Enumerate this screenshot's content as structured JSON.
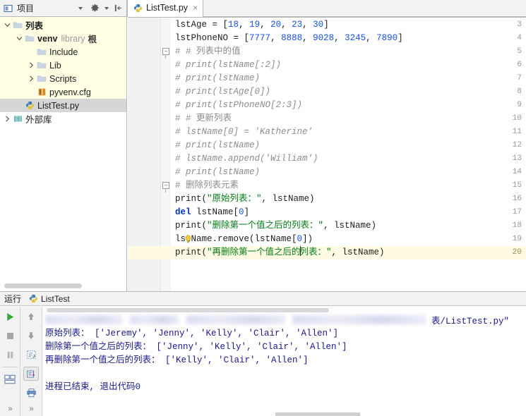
{
  "window": {
    "project_tool_title": "项目",
    "editor_tab": {
      "label": "ListTest.py",
      "close": "×"
    }
  },
  "toolbar": {
    "project_icon": "project-module-icon",
    "dropdown_icon": "chevron-down-icon",
    "settings_icon": "gear-icon",
    "settings_caret": "chevron-down-icon",
    "collapse_icon": "collapse-panel-icon"
  },
  "sidebar": {
    "tree": [
      {
        "id": "lists-root",
        "label": "列表",
        "sub": "",
        "indent": 0,
        "arrow": "expanded",
        "icon": "folder-icon",
        "bold": true,
        "selected": false,
        "yellow": true
      },
      {
        "id": "venv",
        "label": "venv",
        "sub": "library 根",
        "indent": 1,
        "arrow": "expanded",
        "icon": "folder-icon",
        "bold": true,
        "selected": false,
        "yellow": true
      },
      {
        "id": "include",
        "label": "Include",
        "sub": "",
        "indent": 2,
        "arrow": "none",
        "icon": "folder-icon",
        "bold": false,
        "selected": false,
        "yellow": true
      },
      {
        "id": "lib",
        "label": "Lib",
        "sub": "",
        "indent": 2,
        "arrow": "collapsed",
        "icon": "folder-icon",
        "bold": false,
        "selected": false,
        "yellow": true
      },
      {
        "id": "scripts",
        "label": "Scripts",
        "sub": "",
        "indent": 2,
        "arrow": "collapsed",
        "icon": "folder-icon",
        "bold": false,
        "selected": false,
        "yellow": true
      },
      {
        "id": "pyvenv-cfg",
        "label": "pyvenv.cfg",
        "sub": "",
        "indent": 2,
        "arrow": "none",
        "icon": "config-file-icon",
        "bold": false,
        "selected": false,
        "yellow": true
      },
      {
        "id": "listtest-py",
        "label": "ListTest.py",
        "sub": "",
        "indent": 1,
        "arrow": "none",
        "icon": "python-file-icon",
        "bold": false,
        "selected": true,
        "yellow": false
      },
      {
        "id": "external-libs",
        "label": "外部库",
        "sub": "",
        "indent": 0,
        "arrow": "collapsed",
        "icon": "library-icon",
        "bold": false,
        "selected": false,
        "yellow": false
      }
    ]
  },
  "editor": {
    "current_line": 20,
    "lines": [
      {
        "n": 3,
        "fold": null,
        "tokens": [
          {
            "t": "lstAge ",
            "c": "fn"
          },
          {
            "t": "= ",
            "c": "fn"
          },
          {
            "t": "[",
            "c": "fn"
          },
          {
            "t": "18",
            "c": "num"
          },
          {
            "t": ", ",
            "c": "fn"
          },
          {
            "t": "19",
            "c": "num"
          },
          {
            "t": ", ",
            "c": "fn"
          },
          {
            "t": "20",
            "c": "num"
          },
          {
            "t": ", ",
            "c": "fn"
          },
          {
            "t": "23",
            "c": "num"
          },
          {
            "t": ", ",
            "c": "fn"
          },
          {
            "t": "30",
            "c": "num"
          },
          {
            "t": "]",
            "c": "fn"
          }
        ]
      },
      {
        "n": 4,
        "fold": null,
        "tokens": [
          {
            "t": "lstPhoneNO ",
            "c": "fn"
          },
          {
            "t": "= ",
            "c": "fn"
          },
          {
            "t": "[",
            "c": "fn"
          },
          {
            "t": "7777",
            "c": "num"
          },
          {
            "t": ", ",
            "c": "fn"
          },
          {
            "t": "8888",
            "c": "num"
          },
          {
            "t": ", ",
            "c": "fn"
          },
          {
            "t": "9028",
            "c": "num"
          },
          {
            "t": ", ",
            "c": "fn"
          },
          {
            "t": "3245",
            "c": "num"
          },
          {
            "t": ", ",
            "c": "fn"
          },
          {
            "t": "7890",
            "c": "num"
          },
          {
            "t": "]",
            "c": "fn"
          }
        ]
      },
      {
        "n": 5,
        "fold": "open",
        "tokens": [
          {
            "t": "# # 列表中的值",
            "c": "cmz"
          }
        ]
      },
      {
        "n": 6,
        "fold": null,
        "tokens": [
          {
            "t": "# print(lstName[:2])",
            "c": "cm"
          }
        ]
      },
      {
        "n": 7,
        "fold": null,
        "tokens": [
          {
            "t": "# print(lstName)",
            "c": "cm"
          }
        ]
      },
      {
        "n": 8,
        "fold": null,
        "tokens": [
          {
            "t": "# print(lstAge[0])",
            "c": "cm"
          }
        ]
      },
      {
        "n": 9,
        "fold": null,
        "tokens": [
          {
            "t": "# print(lstPhoneNO[2:3])",
            "c": "cm"
          }
        ]
      },
      {
        "n": 10,
        "fold": null,
        "tokens": [
          {
            "t": "# # 更新列表",
            "c": "cmz"
          }
        ]
      },
      {
        "n": 11,
        "fold": null,
        "tokens": [
          {
            "t": "# lstName[0] = 'Katherine'",
            "c": "cm"
          }
        ]
      },
      {
        "n": 12,
        "fold": null,
        "tokens": [
          {
            "t": "# print(lstName)",
            "c": "cm"
          }
        ]
      },
      {
        "n": 13,
        "fold": null,
        "tokens": [
          {
            "t": "# lstName.append('William')",
            "c": "cm"
          }
        ]
      },
      {
        "n": 14,
        "fold": null,
        "tokens": [
          {
            "t": "# print(lstName)",
            "c": "cm"
          }
        ]
      },
      {
        "n": 15,
        "fold": "open",
        "tokens": [
          {
            "t": "# 删除列表元素",
            "c": "cmz"
          }
        ]
      },
      {
        "n": 16,
        "fold": null,
        "tokens": [
          {
            "t": "print(",
            "c": "fn"
          },
          {
            "t": "\"原始列表：\"",
            "c": "str"
          },
          {
            "t": ", lstName)",
            "c": "fn"
          }
        ]
      },
      {
        "n": 17,
        "fold": null,
        "tokens": [
          {
            "t": "del",
            "c": "kw"
          },
          {
            "t": " lstName[",
            "c": "fn"
          },
          {
            "t": "0",
            "c": "num"
          },
          {
            "t": "]",
            "c": "fn"
          }
        ]
      },
      {
        "n": 18,
        "fold": null,
        "tokens": [
          {
            "t": "print(",
            "c": "fn"
          },
          {
            "t": "\"删除第一个值之后的列表：\"",
            "c": "str"
          },
          {
            "t": ", lstName)",
            "c": "fn"
          }
        ]
      },
      {
        "n": 19,
        "fold": null,
        "bulb": true,
        "tokens": [
          {
            "t": "lstName.remove(lstName[",
            "c": "fn"
          },
          {
            "t": "0",
            "c": "num"
          },
          {
            "t": "])",
            "c": "fn"
          }
        ]
      },
      {
        "n": 20,
        "fold": null,
        "caret_after": 18,
        "tokens": [
          {
            "t": "print(",
            "c": "fn"
          },
          {
            "t": "\"再删除第一个值之后的",
            "c": "str"
          },
          {
            "t": "列表：\"",
            "c": "str"
          },
          {
            "t": ", lstName)",
            "c": "fn"
          }
        ]
      }
    ]
  },
  "run_panel": {
    "header_label": "运行",
    "config_name": "ListTest",
    "config_icon": "python-file-icon",
    "toolbar_left": [
      {
        "name": "rerun-button",
        "icon": "play-icon"
      },
      {
        "name": "stop-button",
        "icon": "stop-icon"
      },
      {
        "name": "pause-button",
        "icon": "pause-icon"
      },
      {
        "name": "toggle-tasks-button",
        "icon": "layout-icon"
      },
      {
        "name": "more-left-button",
        "icon": "chevron-double-right-icon"
      }
    ],
    "toolbar_right": [
      {
        "name": "up-stack-button",
        "icon": "arrow-up-icon"
      },
      {
        "name": "down-stack-button",
        "icon": "arrow-down-icon"
      },
      {
        "name": "soft-wrap-button",
        "icon": "soft-wrap-icon"
      },
      {
        "name": "scroll-to-end-button",
        "icon": "scroll-end-icon"
      },
      {
        "name": "print-button",
        "icon": "printer-icon"
      },
      {
        "name": "more-right-button",
        "icon": "chevron-double-right-icon"
      }
    ],
    "console": {
      "command_line_tail": "表/ListTest.py\"",
      "lines": [
        "原始列表： ['Jeremy', 'Jenny', 'Kelly', 'Clair', 'Allen']",
        "删除第一个值之后的列表： ['Jenny', 'Kelly', 'Clair', 'Allen']",
        "再删除第一个值之后的列表： ['Kelly', 'Clair', 'Allen']",
        "",
        "进程已结束, 退出代码0"
      ]
    }
  },
  "colors": {
    "keyword": "#0033b3",
    "number": "#1750eb",
    "string": "#067d17",
    "comment": "#8c8c8c",
    "console_text": "#1a1a88",
    "tree_highlight": "#ffffe4",
    "selection": "#d6d6d6",
    "current_line": "#fffae3"
  }
}
